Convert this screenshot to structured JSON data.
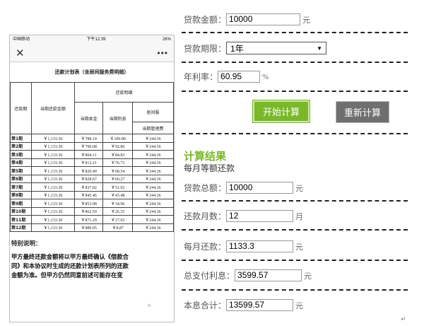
{
  "phone": {
    "carrier": "中国移动",
    "time": "下午12:39",
    "battery": "26%",
    "close_icon": "close-icon",
    "more_icon": "more-icon",
    "doc_title": "还款计划表（含居间服务费明细）",
    "headers": {
      "period": "还款期",
      "current_total": "当期还款金额",
      "detail": "还款明细",
      "principal": "当期本金",
      "interest": "当期利息",
      "broker": "居间服",
      "mgmt": "当期管理费"
    },
    "rows": [
      {
        "period": "第1期",
        "total": "￥1,133.30",
        "principal": "￥788.14",
        "interest": "￥100.80",
        "fee": "￥244.36"
      },
      {
        "period": "第2期",
        "total": "￥1,133.30",
        "principal": "￥796.08",
        "interest": "￥92.86",
        "fee": "￥244.36"
      },
      {
        "period": "第3期",
        "total": "￥1,133.30",
        "principal": "￥804.11",
        "interest": "￥84.83",
        "fee": "￥244.36"
      },
      {
        "period": "第4期",
        "total": "￥1,133.30",
        "principal": "￥812.21",
        "interest": "￥76.73",
        "fee": "￥244.36"
      },
      {
        "period": "第5期",
        "total": "￥1,133.30",
        "principal": "￥820.40",
        "interest": "￥68.54",
        "fee": "￥244.36"
      },
      {
        "period": "第6期",
        "total": "￥1,133.30",
        "principal": "￥828.67",
        "interest": "￥60.27",
        "fee": "￥244.36"
      },
      {
        "period": "第7期",
        "total": "￥1,133.30",
        "principal": "￥837.02",
        "interest": "￥51.92",
        "fee": "￥244.36"
      },
      {
        "period": "第8期",
        "total": "￥1,133.30",
        "principal": "￥845.46",
        "interest": "￥43.48",
        "fee": "￥244.36"
      },
      {
        "period": "第9期",
        "total": "￥1,133.30",
        "principal": "￥853.98",
        "interest": "￥34.96",
        "fee": "￥244.36"
      },
      {
        "period": "第10期",
        "total": "￥1,133.30",
        "principal": "￥862.59",
        "interest": "￥26.35",
        "fee": "￥244.36"
      },
      {
        "period": "第11期",
        "total": "￥1,133.30",
        "principal": "￥871.29",
        "interest": "￥17.65",
        "fee": "￥244.36"
      },
      {
        "period": "第12期",
        "total": "￥1,133.30",
        "principal": "￥880.05",
        "interest": "￥8.87",
        "fee": "￥244.36"
      }
    ],
    "notes_title": "特别说明：",
    "notes_lines": [
      "甲方最终还款金额将以甲方最终确认《借款合",
      "同》和本协议时生成的还款计划表所列的还款",
      "金额为准。但甲方仍然同意前述可能存在变"
    ]
  },
  "calc": {
    "loan_amount_label": "贷款金额：",
    "loan_amount_value": "10000",
    "loan_amount_unit": "元",
    "loan_term_label": "贷款期限：",
    "loan_term_value": "1年",
    "annual_rate_label": "年利率：",
    "annual_rate_value": "60.95",
    "annual_rate_unit": "%",
    "start_button": "开始计算",
    "reset_button": "重新计算",
    "result_title": "计算结果",
    "result_subtitle": "每月等额还款",
    "total_loan_label": "贷款总额：",
    "total_loan_value": "10000",
    "total_loan_unit": "元",
    "months_label": "还款月数：",
    "months_value": "12",
    "months_unit": "月",
    "monthly_label": "每月还款：",
    "monthly_value": "1133.3",
    "monthly_unit": "元",
    "interest_label": "总支付利息：",
    "interest_value": "3599.57",
    "interest_unit": "元",
    "total_label": "本息合计：",
    "total_value": "13599.57",
    "total_unit": "元"
  },
  "colors": {
    "accent_green": "#7ab82a",
    "reset_gray": "#6f6f6f"
  }
}
